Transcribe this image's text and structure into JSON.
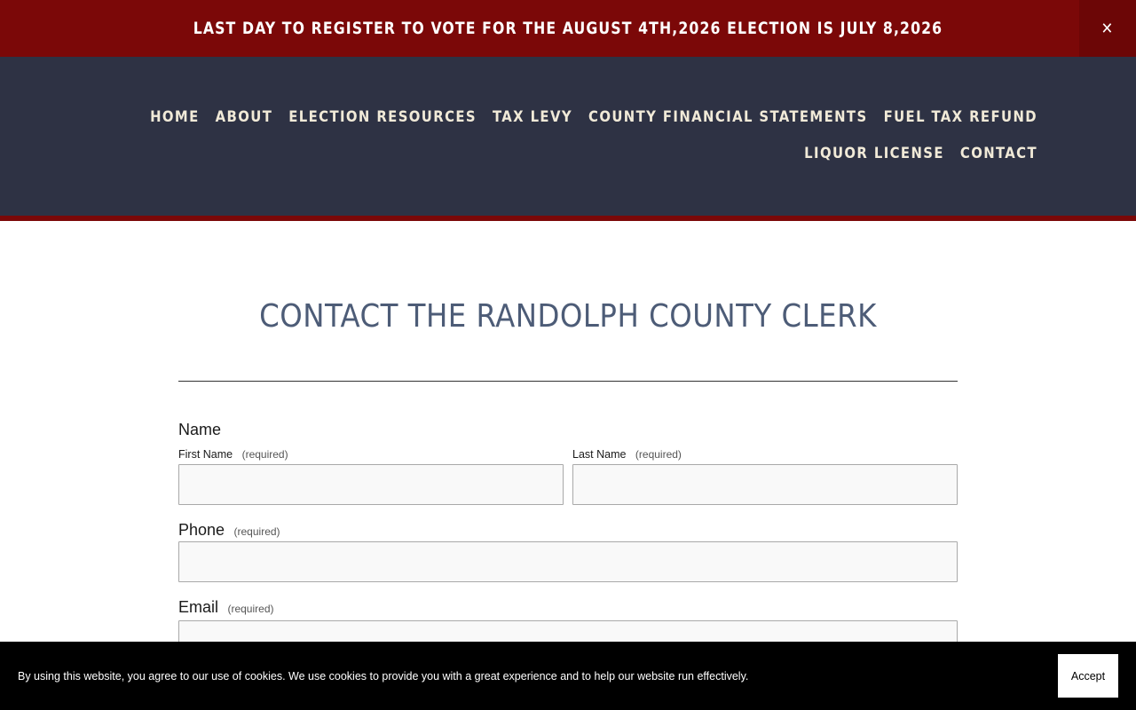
{
  "announcement": {
    "text": "LAST DAY TO REGISTER TO VOTE FOR THE AUGUST 4TH,2026 ELECTION IS JULY 8,2026",
    "close_label": "✕"
  },
  "nav": {
    "items": [
      {
        "label": "HOME"
      },
      {
        "label": "ABOUT"
      },
      {
        "label": "ELECTION RESOURCES"
      },
      {
        "label": "TAX LEVY"
      },
      {
        "label": "COUNTY FINANCIAL STATEMENTS"
      },
      {
        "label": "FUEL TAX REFUND"
      },
      {
        "label": "LIQUOR LICENSE"
      },
      {
        "label": "CONTACT"
      }
    ]
  },
  "main": {
    "title": "CONTACT THE RANDOLPH COUNTY CLERK"
  },
  "form": {
    "name": {
      "label": "Name",
      "first_label": "First Name",
      "last_label": "Last Name",
      "required": "(required)"
    },
    "phone": {
      "label": "Phone",
      "required": "(required)"
    },
    "email": {
      "label": "Email",
      "required": "(required)"
    }
  },
  "cookie": {
    "text": "By using this website, you agree to our use of cookies. We use cookies to provide you with a great experience and to help our website run effectively.",
    "accept_label": "Accept"
  },
  "colors": {
    "banner": "#7b0808",
    "header": "#2e3244",
    "nav_text": "#f1ead8",
    "title": "#4d5c77"
  }
}
